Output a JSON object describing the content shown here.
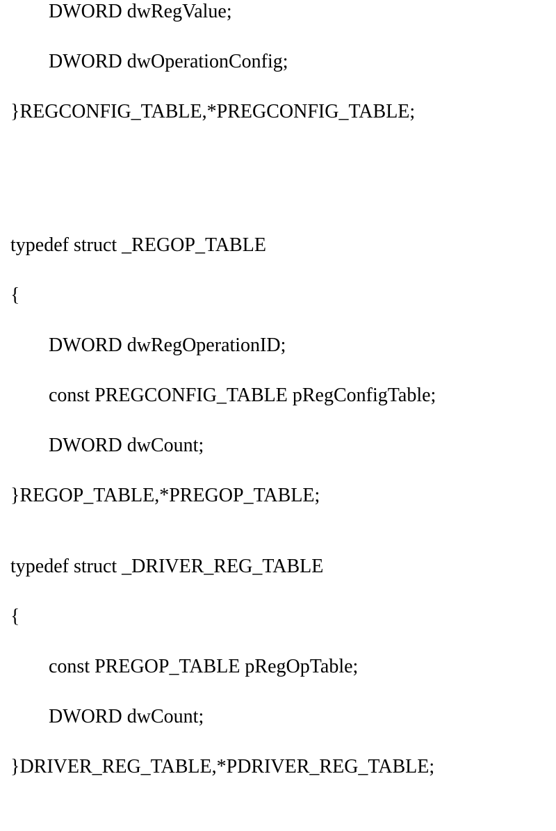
{
  "code": {
    "line1": "DWORD dwRegValue;",
    "line2": "DWORD dwOperationConfig;",
    "line3": "}REGCONFIG_TABLE,*PREGCONFIG_TABLE;",
    "line4": "typedef struct _REGOP_TABLE",
    "line5": "{",
    "line6": "DWORD dwRegOperationID;",
    "line7": "const PREGCONFIG_TABLE pRegConfigTable;",
    "line8": "DWORD dwCount;",
    "line9": "}REGOP_TABLE,*PREGOP_TABLE;",
    "line10": "typedef struct _DRIVER_REG_TABLE",
    "line11": "{",
    "line12": "const PREGOP_TABLE pRegOpTable;",
    "line13": "DWORD dwCount;",
    "line14": "}DRIVER_REG_TABLE,*PDRIVER_REG_TABLE;"
  }
}
